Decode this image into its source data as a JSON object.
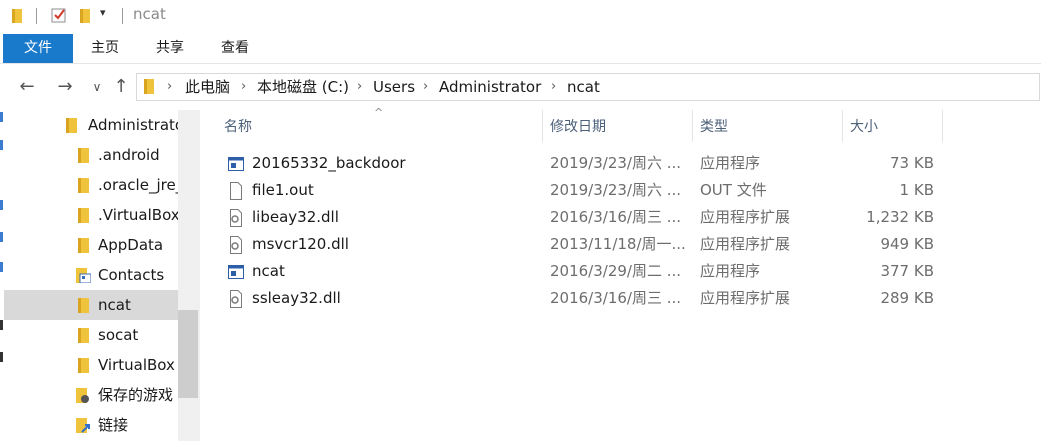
{
  "window": {
    "title": "ncat"
  },
  "ribbon": {
    "tabs": [
      "文件",
      "主页",
      "共享",
      "查看"
    ]
  },
  "address": {
    "crumbs": [
      "此电脑",
      "本地磁盘 (C:)",
      "Users",
      "Administrator",
      "ncat"
    ]
  },
  "nav": {
    "items": [
      {
        "label": "Administrator",
        "icon": "folder-icon",
        "selected": false
      },
      {
        "label": ".android",
        "icon": "folder-icon",
        "selected": false
      },
      {
        "label": ".oracle_jre_usage",
        "icon": "folder-icon",
        "selected": false
      },
      {
        "label": ".VirtualBox",
        "icon": "folder-icon",
        "selected": false
      },
      {
        "label": "AppData",
        "icon": "folder-icon",
        "selected": false
      },
      {
        "label": "Contacts",
        "icon": "contacts-folder-icon",
        "selected": false
      },
      {
        "label": "ncat",
        "icon": "folder-icon",
        "selected": true
      },
      {
        "label": "socat",
        "icon": "folder-icon",
        "selected": false
      },
      {
        "label": "VirtualBox VMs",
        "icon": "folder-icon",
        "selected": false
      },
      {
        "label": "保存的游戏",
        "icon": "saved-games-icon",
        "selected": false
      },
      {
        "label": "链接",
        "icon": "links-icon",
        "selected": false
      }
    ]
  },
  "columns": {
    "name": "名称",
    "date": "修改日期",
    "type": "类型",
    "size": "大小"
  },
  "files": [
    {
      "name": "20165332_backdoor",
      "date": "2019/3/23/周六 ...",
      "type": "应用程序",
      "size": "73 KB",
      "icon": "exe-icon"
    },
    {
      "name": "file1.out",
      "date": "2019/3/23/周六 ...",
      "type": "OUT 文件",
      "size": "1 KB",
      "icon": "file-icon"
    },
    {
      "name": "libeay32.dll",
      "date": "2016/3/16/周三 ...",
      "type": "应用程序扩展",
      "size": "1,232 KB",
      "icon": "dll-icon"
    },
    {
      "name": "msvcr120.dll",
      "date": "2013/11/18/周一...",
      "type": "应用程序扩展",
      "size": "949 KB",
      "icon": "dll-icon"
    },
    {
      "name": "ncat",
      "date": "2016/3/29/周二 ...",
      "type": "应用程序",
      "size": "377 KB",
      "icon": "exe-icon"
    },
    {
      "name": "ssleay32.dll",
      "date": "2016/3/16/周三 ...",
      "type": "应用程序扩展",
      "size": "289 KB",
      "icon": "dll-icon"
    }
  ],
  "colors": {
    "accent": "#1979ca",
    "folder": "#f0c33c",
    "selected_bg": "#d9d9d9"
  }
}
